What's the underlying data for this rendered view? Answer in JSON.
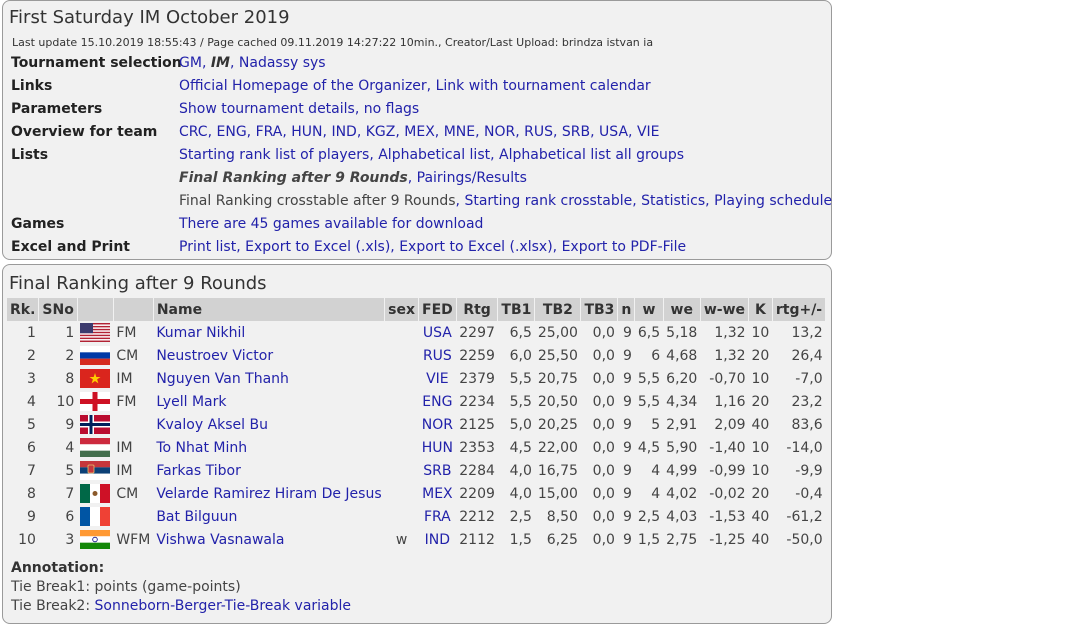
{
  "header": {
    "title": "First Saturday IM October 2019",
    "meta": "Last update 15.10.2019 18:55:43 / Page cached 09.11.2019 14:27:22 10min., Creator/Last Upload: brindza istvan ia"
  },
  "info": {
    "tournament_selection": {
      "label": "Tournament selection",
      "gm": "GM",
      "im": "IM",
      "nadassy": "Nadassy sys"
    },
    "links": {
      "label": "Links",
      "homepage": "Official Homepage of the Organizer",
      "calendar": "Link with tournament calendar"
    },
    "parameters": {
      "label": "Parameters",
      "details": "Show tournament details",
      "flags": "no flags"
    },
    "overview": {
      "label": "Overview for team",
      "teams": [
        "CRC",
        "ENG",
        "FRA",
        "HUN",
        "IND",
        "KGZ",
        "MEX",
        "MNE",
        "NOR",
        "RUS",
        "SRB",
        "USA",
        "VIE"
      ]
    },
    "lists": {
      "label": "Lists",
      "starting_rank": "Starting rank list of players",
      "alphabetical": "Alphabetical list",
      "alphabetical_all": "Alphabetical list all groups",
      "final_ranking": "Final Ranking after 9 Rounds",
      "pairings": "Pairings/Results",
      "crosstable_plain": "Final Ranking crosstable after 9 Rounds",
      "starting_crosstable": "Starting rank crosstable",
      "statistics": "Statistics",
      "schedule": "Playing schedule"
    },
    "games": {
      "label": "Games",
      "download": "There are 45 games available for download"
    },
    "excel": {
      "label": "Excel and Print",
      "print": "Print list",
      "xls": "Export to Excel (.xls)",
      "xlsx": "Export to Excel (.xlsx)",
      "pdf": "Export to PDF-File"
    }
  },
  "ranking": {
    "title": "Final Ranking after 9 Rounds",
    "columns": [
      "Rk.",
      "SNo",
      "",
      "",
      "Name",
      "sex",
      "FED",
      "Rtg",
      "TB1",
      "TB2",
      "TB3",
      "n",
      "w",
      "we",
      "w-we",
      "K",
      "rtg+/-"
    ],
    "rows": [
      {
        "rk": "1",
        "sno": "1",
        "flag": "usa",
        "title": "FM",
        "name": "Kumar Nikhil",
        "sex": "",
        "fed": "USA",
        "rtg": "2297",
        "tb1": "6,5",
        "tb2": "25,00",
        "tb3": "0,0",
        "n": "9",
        "w": "6,5",
        "we": "5,18",
        "wwe": "1,32",
        "k": "10",
        "rtgd": "13,2"
      },
      {
        "rk": "2",
        "sno": "2",
        "flag": "rus",
        "title": "CM",
        "name": "Neustroev Victor",
        "sex": "",
        "fed": "RUS",
        "rtg": "2259",
        "tb1": "6,0",
        "tb2": "25,50",
        "tb3": "0,0",
        "n": "9",
        "w": "6",
        "we": "4,68",
        "wwe": "1,32",
        "k": "20",
        "rtgd": "26,4"
      },
      {
        "rk": "3",
        "sno": "8",
        "flag": "vie",
        "title": "IM",
        "name": "Nguyen Van Thanh",
        "sex": "",
        "fed": "VIE",
        "rtg": "2379",
        "tb1": "5,5",
        "tb2": "20,75",
        "tb3": "0,0",
        "n": "9",
        "w": "5,5",
        "we": "6,20",
        "wwe": "-0,70",
        "k": "10",
        "rtgd": "-7,0"
      },
      {
        "rk": "4",
        "sno": "10",
        "flag": "eng",
        "title": "FM",
        "name": "Lyell Mark",
        "sex": "",
        "fed": "ENG",
        "rtg": "2234",
        "tb1": "5,5",
        "tb2": "20,50",
        "tb3": "0,0",
        "n": "9",
        "w": "5,5",
        "we": "4,34",
        "wwe": "1,16",
        "k": "20",
        "rtgd": "23,2"
      },
      {
        "rk": "5",
        "sno": "9",
        "flag": "nor",
        "title": "",
        "name": "Kvaloy Aksel Bu",
        "sex": "",
        "fed": "NOR",
        "rtg": "2125",
        "tb1": "5,0",
        "tb2": "20,25",
        "tb3": "0,0",
        "n": "9",
        "w": "5",
        "we": "2,91",
        "wwe": "2,09",
        "k": "40",
        "rtgd": "83,6"
      },
      {
        "rk": "6",
        "sno": "4",
        "flag": "hun",
        "title": "IM",
        "name": "To Nhat Minh",
        "sex": "",
        "fed": "HUN",
        "rtg": "2353",
        "tb1": "4,5",
        "tb2": "22,00",
        "tb3": "0,0",
        "n": "9",
        "w": "4,5",
        "we": "5,90",
        "wwe": "-1,40",
        "k": "10",
        "rtgd": "-14,0"
      },
      {
        "rk": "7",
        "sno": "5",
        "flag": "srb",
        "title": "IM",
        "name": "Farkas Tibor",
        "sex": "",
        "fed": "SRB",
        "rtg": "2284",
        "tb1": "4,0",
        "tb2": "16,75",
        "tb3": "0,0",
        "n": "9",
        "w": "4",
        "we": "4,99",
        "wwe": "-0,99",
        "k": "10",
        "rtgd": "-9,9"
      },
      {
        "rk": "8",
        "sno": "7",
        "flag": "mex",
        "title": "CM",
        "name": "Velarde Ramirez Hiram De Jesus",
        "sex": "",
        "fed": "MEX",
        "rtg": "2209",
        "tb1": "4,0",
        "tb2": "15,00",
        "tb3": "0,0",
        "n": "9",
        "w": "4",
        "we": "4,02",
        "wwe": "-0,02",
        "k": "20",
        "rtgd": "-0,4"
      },
      {
        "rk": "9",
        "sno": "6",
        "flag": "fra",
        "title": "",
        "name": "Bat Bilguun",
        "sex": "",
        "fed": "FRA",
        "rtg": "2212",
        "tb1": "2,5",
        "tb2": "8,50",
        "tb3": "0,0",
        "n": "9",
        "w": "2,5",
        "we": "4,03",
        "wwe": "-1,53",
        "k": "40",
        "rtgd": "-61,2"
      },
      {
        "rk": "10",
        "sno": "3",
        "flag": "ind",
        "title": "WFM",
        "name": "Vishwa Vasnawala",
        "sex": "w",
        "fed": "IND",
        "rtg": "2112",
        "tb1": "1,5",
        "tb2": "6,25",
        "tb3": "0,0",
        "n": "9",
        "w": "1,5",
        "we": "2,75",
        "wwe": "-1,25",
        "k": "40",
        "rtgd": "-50,0"
      }
    ]
  },
  "annotation": {
    "title": "Annotation:",
    "tb1_prefix": "Tie Break1: ",
    "tb1_text": "points (game-points)",
    "tb2_prefix": "Tie Break2: ",
    "tb2_link": "Sonneborn-Berger-Tie-Break variable"
  },
  "colors": {
    "link": "#2222aa",
    "panel_bg": "#f1f1f1",
    "header_bg": "#d2d2d2",
    "border": "#9a9a9a"
  }
}
